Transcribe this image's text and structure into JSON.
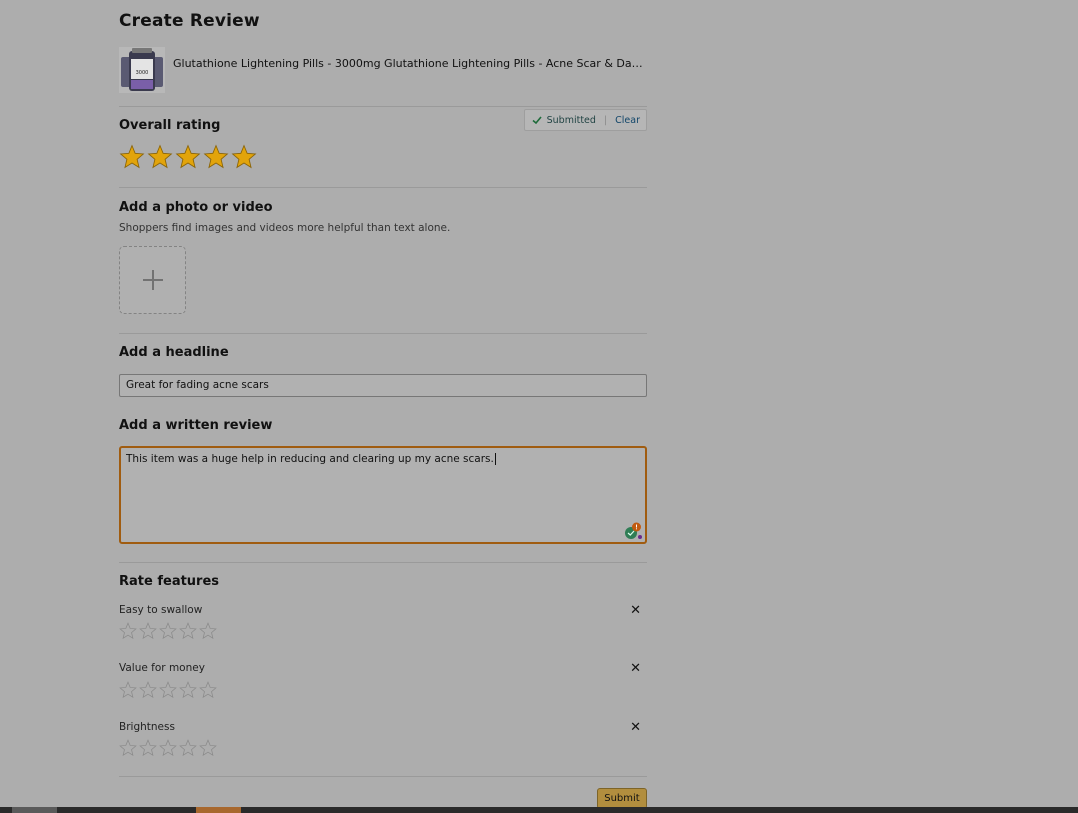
{
  "page": {
    "title": "Create Review"
  },
  "product": {
    "title": "Glutathione Lightening Pills - 3000mg Glutathione Lightening Pills - Acne Scar & Dark Spot Re...",
    "image_label": "3000"
  },
  "rating": {
    "heading": "Overall rating",
    "value": 5,
    "max": 5,
    "status": "Submitted",
    "clear_label": "Clear",
    "star_color": "#e2a40b"
  },
  "media": {
    "heading": "Add a photo or video",
    "subtext": "Shoppers find images and videos more helpful than text alone."
  },
  "headline": {
    "heading": "Add a headline",
    "value": "Great for fading acne scars"
  },
  "review": {
    "heading": "Add a written review",
    "value": "This item was a huge help in reducing and clearing up my acne scars."
  },
  "features": {
    "heading": "Rate features",
    "items": [
      {
        "label": "Easy to swallow",
        "rating": 0
      },
      {
        "label": "Value for money",
        "rating": 0
      },
      {
        "label": "Brightness",
        "rating": 0
      }
    ]
  },
  "submit_label": "Submit"
}
